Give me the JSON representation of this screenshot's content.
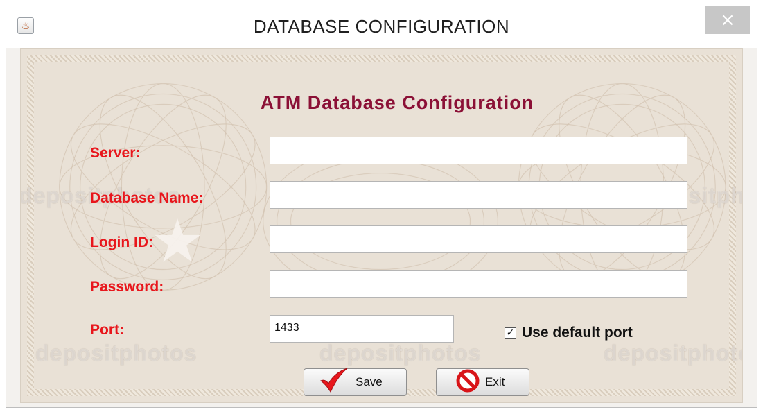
{
  "window": {
    "title": "DATABASE CONFIGURATION",
    "close_label": "×",
    "app_icon_glyph": "♨"
  },
  "form": {
    "heading": "ATM Database Configuration",
    "fields": [
      {
        "label": "Server:",
        "value": ""
      },
      {
        "label": "Database Name:",
        "value": ""
      },
      {
        "label": "Login ID:",
        "value": ""
      },
      {
        "label": "Password:",
        "value": ""
      }
    ],
    "port": {
      "label": "Port:",
      "value": "1433"
    },
    "use_default_port": {
      "label": "Use default port",
      "checked": true,
      "check_glyph": "✓"
    }
  },
  "buttons": {
    "save_label": "Save",
    "exit_label": "Exit"
  },
  "watermarks": [
    "depositphotos",
    "depositphotos",
    "depositphotos",
    "depositphotos",
    "depositphotos"
  ],
  "colors": {
    "label": "#e8161c",
    "heading": "#8b1036",
    "save_icon": "#e8161c",
    "exit_icon": "#d81418"
  }
}
